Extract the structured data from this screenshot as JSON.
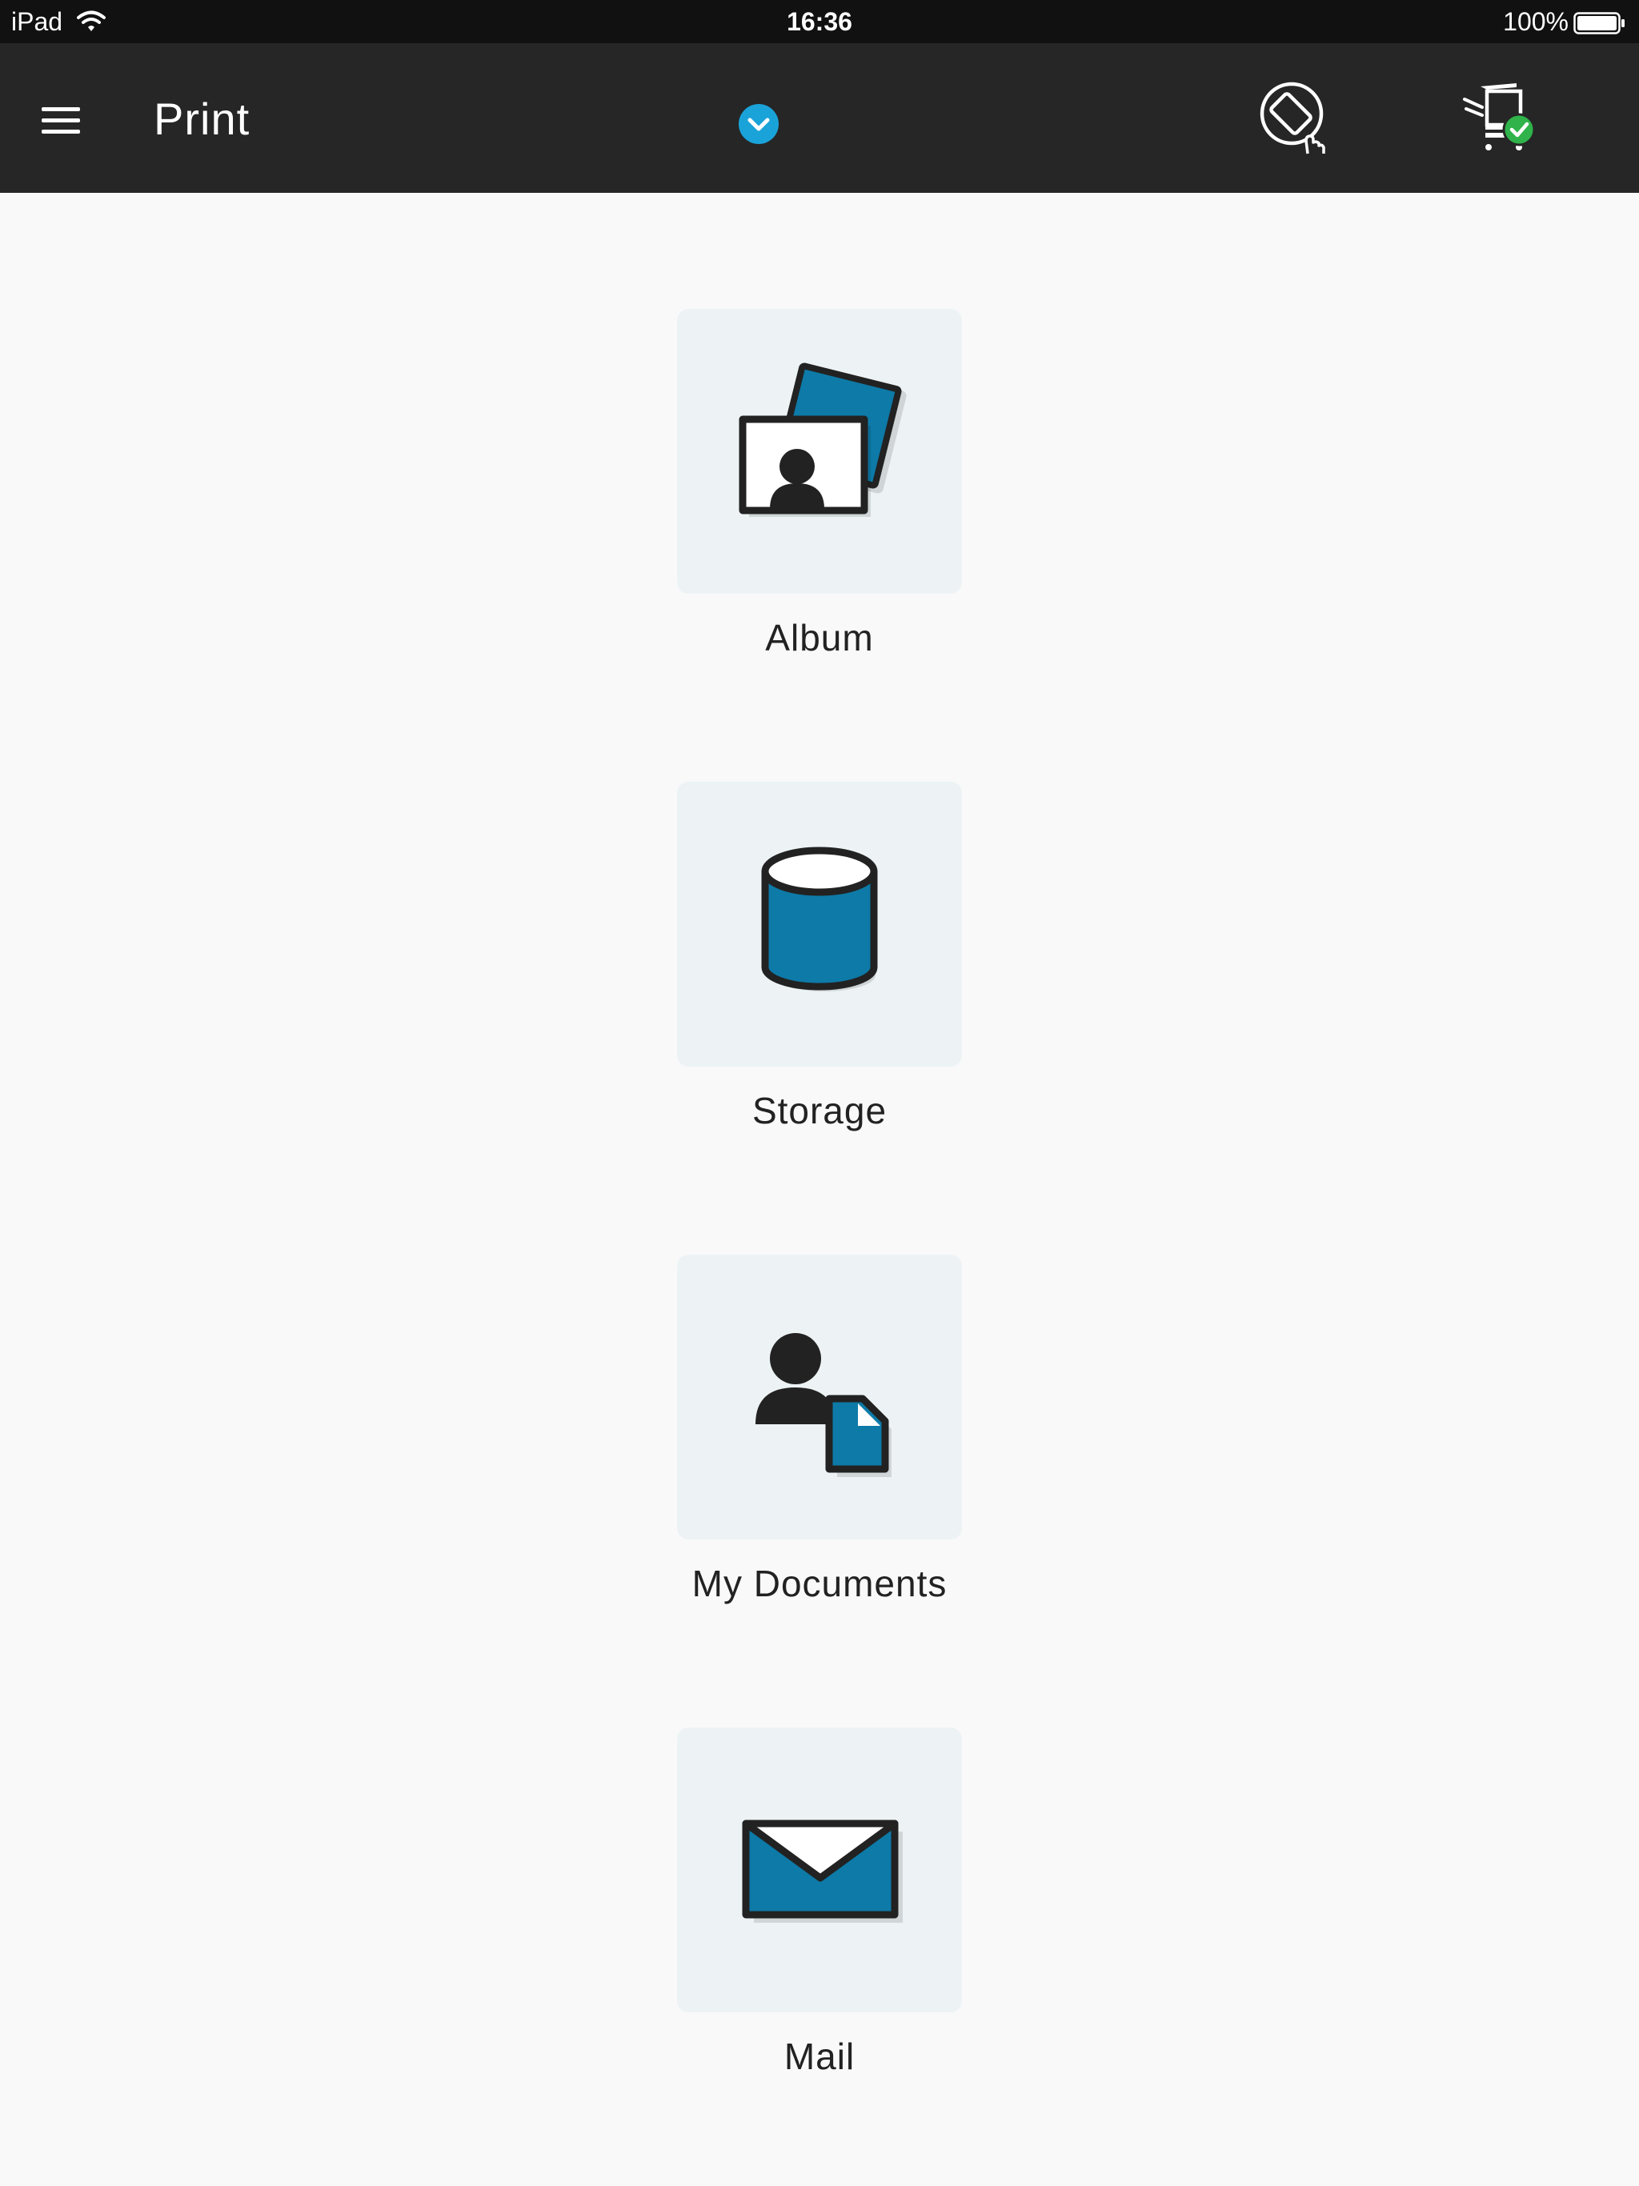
{
  "status_bar": {
    "device": "iPad",
    "time": "16:36",
    "battery": "100%"
  },
  "nav": {
    "title": "Print",
    "menu_icon": "hamburger-menu-icon",
    "dropdown_icon": "chevron-down-circle-icon",
    "rotate_icon": "screen-rotate-icon",
    "printer_icon": "printer-connected-icon"
  },
  "sources": [
    {
      "label": "Album",
      "icon": "photo-album-icon"
    },
    {
      "label": "Storage",
      "icon": "storage-cylinder-icon"
    },
    {
      "label": "My Documents",
      "icon": "my-documents-icon"
    },
    {
      "label": "Mail",
      "icon": "mail-envelope-icon"
    }
  ],
  "colors": {
    "nav_background": "#262626",
    "accent_blue": "#0d7aa8",
    "dropdown_blue": "#1aa3d9",
    "connected_green": "#2fb34a",
    "tile_background": "#edf3f5"
  }
}
